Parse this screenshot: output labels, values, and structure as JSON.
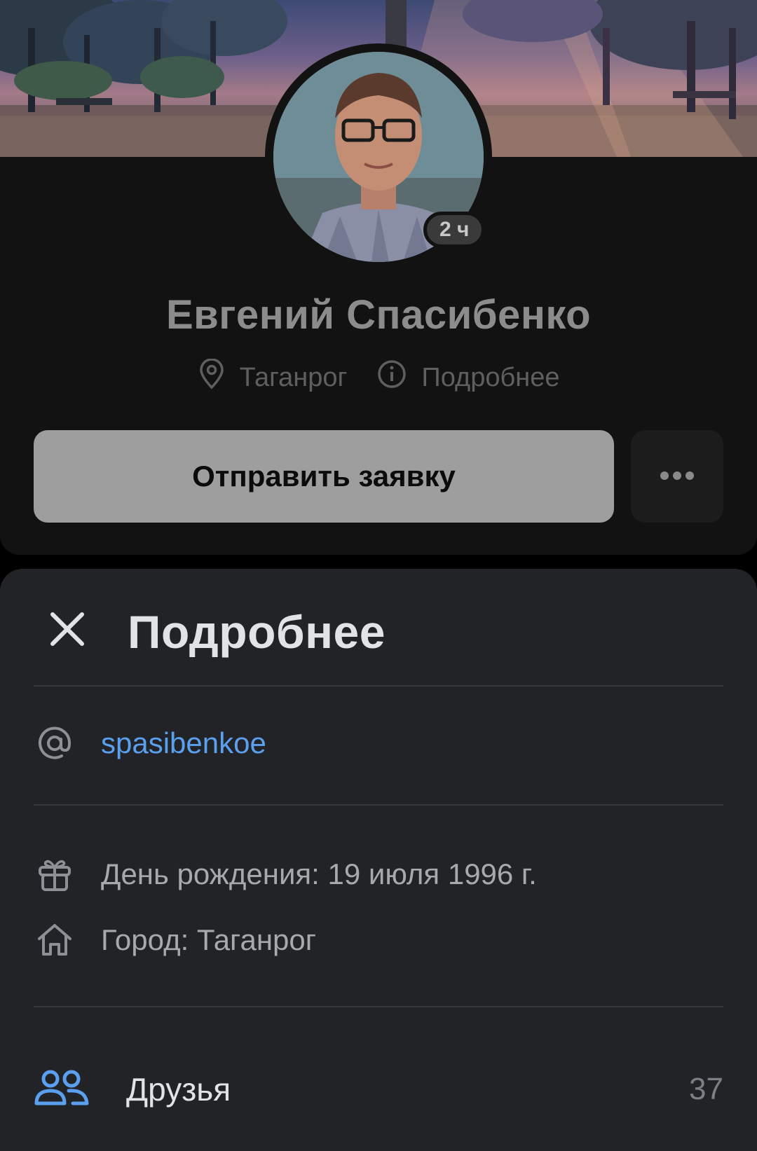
{
  "profile": {
    "name": "Евгений Спасибенко",
    "last_seen_badge": "2 ч",
    "city": "Таганрог",
    "details_link": "Подробнее",
    "primary_button": "Отправить заявку"
  },
  "sheet": {
    "title": "Подробнее",
    "handle": "spasibenkoe",
    "birthday": "День рождения: 19 июля 1996 г.",
    "city": "Город: Таганрог",
    "friends_label": "Друзья",
    "friends_count": "37"
  },
  "colors": {
    "accent": "#5aa0ee",
    "sheet_bg": "#222326",
    "backdrop": "#121212"
  },
  "icons": [
    "location-pin-icon",
    "info-icon",
    "more-dots-icon",
    "close-icon",
    "at-icon",
    "gift-icon",
    "home-icon",
    "friends-icon"
  ]
}
